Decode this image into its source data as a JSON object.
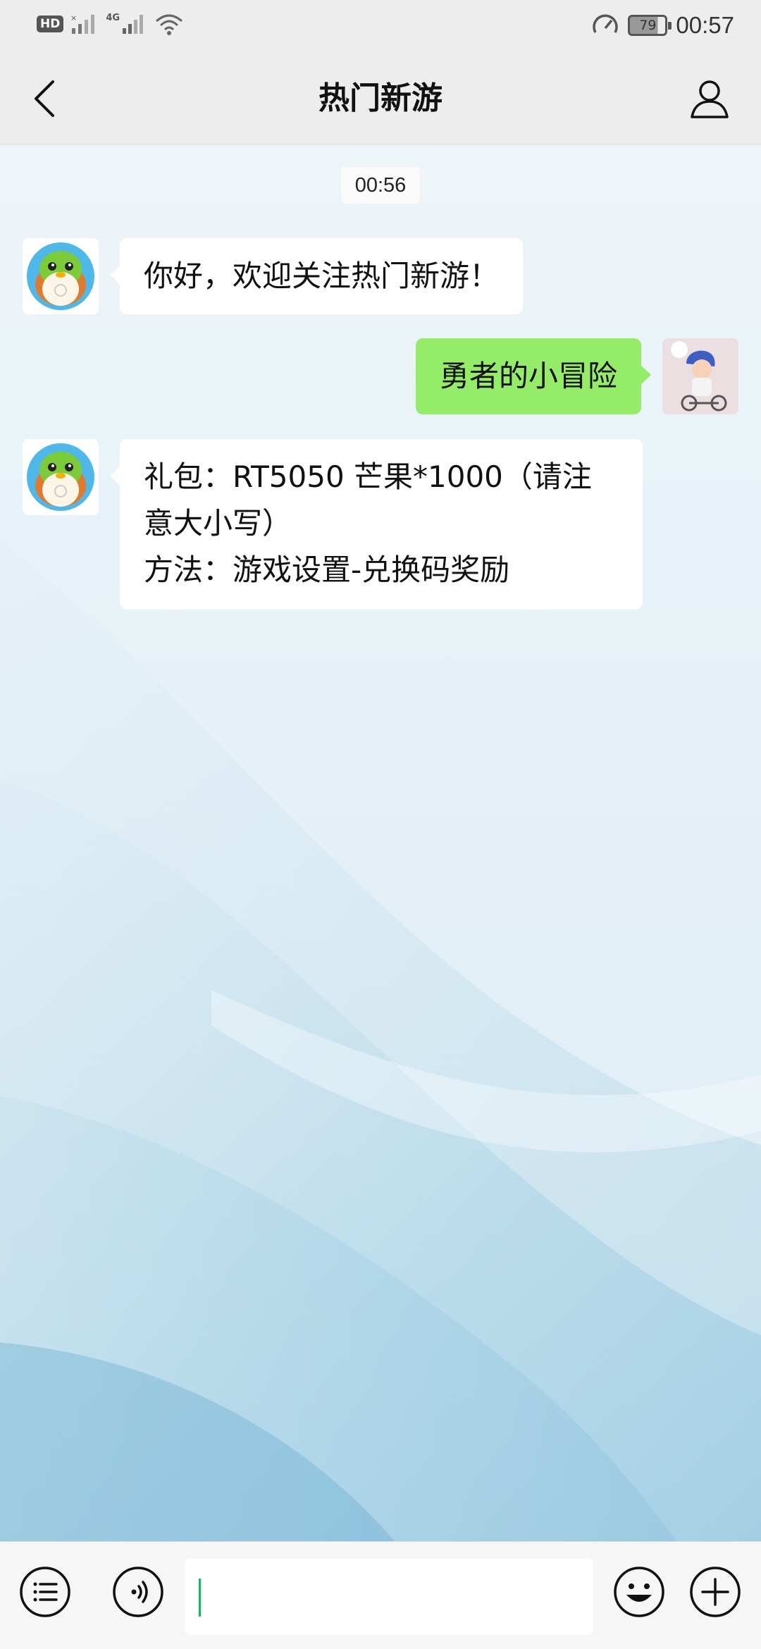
{
  "status_bar": {
    "hd_label": "HD",
    "network_label": "4G",
    "battery_level": "79",
    "time": "00:57"
  },
  "header": {
    "title": "热门新游",
    "back_icon": "chevron-left-icon",
    "profile_icon": "person-icon"
  },
  "chat": {
    "timestamp": "00:56",
    "messages": [
      {
        "sender": "official-account",
        "text": "你好，欢迎关注热门新游！"
      },
      {
        "sender": "me",
        "text": "勇者的小冒险"
      },
      {
        "sender": "official-account",
        "lines": [
          "礼包：RT5050 芒果*1000（请注",
          "意大小写）",
          "方法：游戏设置-兑换码奖励"
        ]
      }
    ]
  },
  "input_bar": {
    "menu_icon": "menu-list-icon",
    "voice_icon": "voice-icon",
    "input_value": "",
    "emoji_icon": "emoji-icon",
    "add_icon": "plus-icon"
  },
  "colors": {
    "bubble_out": "#95ec69",
    "bubble_in": "#ffffff",
    "bar_bg": "#ededed",
    "caret": "#07c160"
  }
}
